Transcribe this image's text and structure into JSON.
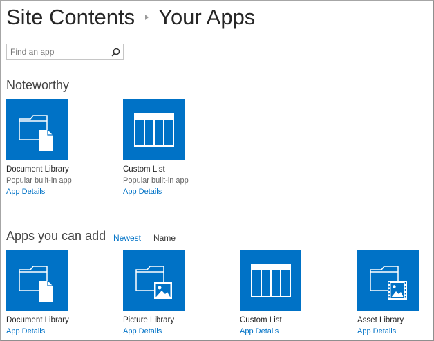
{
  "header": {
    "breadcrumb_root": "Site Contents",
    "page_title": "Your Apps"
  },
  "search": {
    "placeholder": "Find an app",
    "icon": "search-icon"
  },
  "noteworthy": {
    "title": "Noteworthy",
    "apps": [
      {
        "name": "Document Library",
        "subtitle": "Popular built-in app",
        "link": "App Details",
        "icon": "document-library-icon"
      },
      {
        "name": "Custom List",
        "subtitle": "Popular built-in app",
        "link": "App Details",
        "icon": "custom-list-icon"
      }
    ]
  },
  "apps_you_can_add": {
    "title": "Apps you can add",
    "sort_options": [
      "Newest",
      "Name"
    ],
    "active_sort": "Newest",
    "apps": [
      {
        "name": "Document Library",
        "link": "App Details",
        "icon": "document-library-icon"
      },
      {
        "name": "Picture Library",
        "link": "App Details",
        "icon": "picture-library-icon"
      },
      {
        "name": "Custom List",
        "link": "App Details",
        "icon": "custom-list-icon"
      },
      {
        "name": "Asset Library",
        "link": "App Details",
        "icon": "asset-library-icon"
      }
    ]
  },
  "colors": {
    "tile_blue": "#0072c6",
    "link_blue": "#0072c6",
    "title_text": "#262626"
  }
}
